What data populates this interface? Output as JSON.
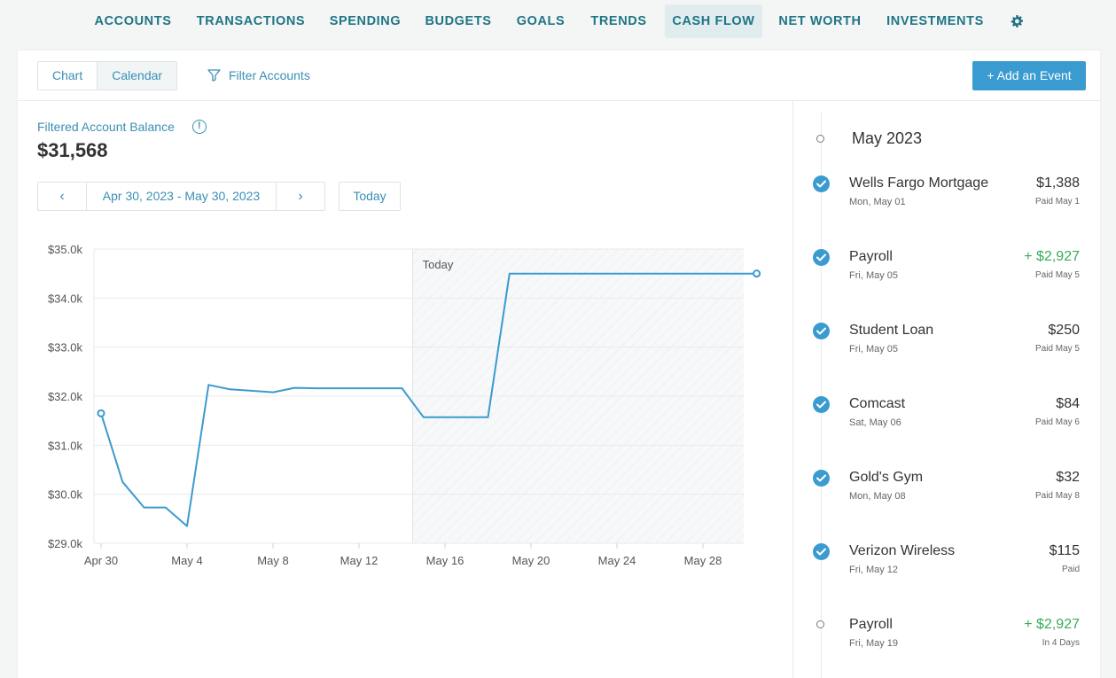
{
  "nav": {
    "items": [
      {
        "label": "ACCOUNTS",
        "active": false
      },
      {
        "label": "TRANSACTIONS",
        "active": false
      },
      {
        "label": "SPENDING",
        "active": false
      },
      {
        "label": "BUDGETS",
        "active": false
      },
      {
        "label": "GOALS",
        "active": false
      },
      {
        "label": "TRENDS",
        "active": false
      },
      {
        "label": "CASH FLOW",
        "active": true
      },
      {
        "label": "NET WORTH",
        "active": false
      },
      {
        "label": "INVESTMENTS",
        "active": false
      }
    ],
    "settings_icon": "gear-icon"
  },
  "toolbar": {
    "view_chart": "Chart",
    "view_calendar": "Calendar",
    "filter_label": "Filter Accounts",
    "filter_icon": "funnel-icon",
    "add_event": "+ Add an Event"
  },
  "balance": {
    "label": "Filtered Account Balance",
    "info_icon": "info-icon",
    "value": "$31,568"
  },
  "date_nav": {
    "prev": "‹",
    "range": "Apr 30, 2023 - May 30, 2023",
    "next": "›",
    "today": "Today"
  },
  "chart_data": {
    "type": "line",
    "title": "",
    "xlabel": "",
    "ylabel": "",
    "x_ticks": [
      "Apr 30",
      "May 4",
      "May 8",
      "May 12",
      "May 16",
      "May 20",
      "May 24",
      "May 28"
    ],
    "y_ticks": [
      "$29.0k",
      "$30.0k",
      "$31.0k",
      "$32.0k",
      "$33.0k",
      "$34.0k",
      "$35.0k"
    ],
    "ylim": [
      29000,
      35000
    ],
    "xlim_days": [
      0,
      30.5
    ],
    "today_label": "Today",
    "today_day": 14.5,
    "series": [
      {
        "points": [
          [
            0,
            31650
          ],
          [
            1,
            30250
          ],
          [
            2,
            29730
          ],
          [
            3,
            29730
          ],
          [
            4,
            29350
          ],
          [
            5,
            32230
          ],
          [
            6,
            32140
          ],
          [
            7,
            32110
          ],
          [
            8,
            32080
          ],
          [
            9,
            32170
          ],
          [
            10,
            32160
          ],
          [
            11,
            32160
          ],
          [
            12,
            32160
          ],
          [
            13,
            32160
          ],
          [
            14,
            32160
          ],
          [
            15,
            31570
          ],
          [
            16,
            31570
          ],
          [
            17,
            31570
          ],
          [
            18,
            31570
          ],
          [
            19,
            34500
          ],
          [
            20,
            34500
          ],
          [
            21,
            34500
          ],
          [
            22,
            34500
          ],
          [
            23,
            34500
          ],
          [
            24,
            34500
          ],
          [
            25,
            34500
          ],
          [
            26,
            34500
          ],
          [
            27,
            34500
          ],
          [
            28,
            34500
          ],
          [
            29,
            34500
          ],
          [
            30.5,
            34500
          ]
        ]
      }
    ],
    "color": "#3a9bd0",
    "grid": true
  },
  "timeline": {
    "month": "May 2023",
    "events": [
      {
        "name": "Wells Fargo Mortgage",
        "date": "Mon, May 01",
        "amount": "$1,388",
        "status": "Paid May 1",
        "paid": true,
        "income": false
      },
      {
        "name": "Payroll",
        "date": "Fri, May 05",
        "amount": "+ $2,927",
        "status": "Paid May 5",
        "paid": true,
        "income": true
      },
      {
        "name": "Student Loan",
        "date": "Fri, May 05",
        "amount": "$250",
        "status": "Paid May 5",
        "paid": true,
        "income": false
      },
      {
        "name": "Comcast",
        "date": "Sat, May 06",
        "amount": "$84",
        "status": "Paid May 6",
        "paid": true,
        "income": false
      },
      {
        "name": "Gold's Gym",
        "date": "Mon, May 08",
        "amount": "$32",
        "status": "Paid May 8",
        "paid": true,
        "income": false
      },
      {
        "name": "Verizon Wireless",
        "date": "Fri, May 12",
        "amount": "$115",
        "status": "Paid",
        "paid": true,
        "income": false
      },
      {
        "name": "Payroll",
        "date": "Fri, May 19",
        "amount": "+ $2,927",
        "status": "In 4 Days",
        "paid": false,
        "income": true
      }
    ]
  }
}
